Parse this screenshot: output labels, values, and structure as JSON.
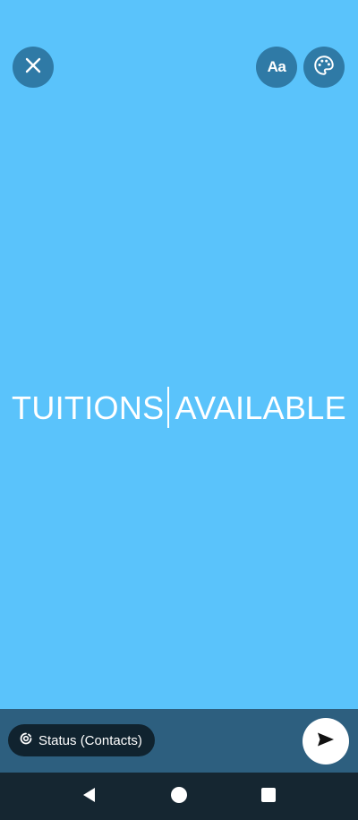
{
  "editor": {
    "status_text_before_cursor": "TUITIONS",
    "status_text_after_cursor": "AVAILABLE",
    "background_color": "#5ac3fb"
  },
  "toolbar": {
    "close_icon": "close-icon",
    "font_button_label": "Aa",
    "palette_icon": "palette-icon"
  },
  "composer": {
    "audience_label": "Status (Contacts)",
    "audience_icon": "status-ring-icon",
    "send_icon": "send-icon"
  },
  "navigation": {
    "back_icon": "back-triangle-icon",
    "home_icon": "home-circle-icon",
    "recents_icon": "recents-square-icon"
  },
  "colors": {
    "button_bg": "#2f7aa6",
    "bottom_bar": "#2d5f7f",
    "pill_bg": "#10232f",
    "nav_bar": "#152631"
  }
}
